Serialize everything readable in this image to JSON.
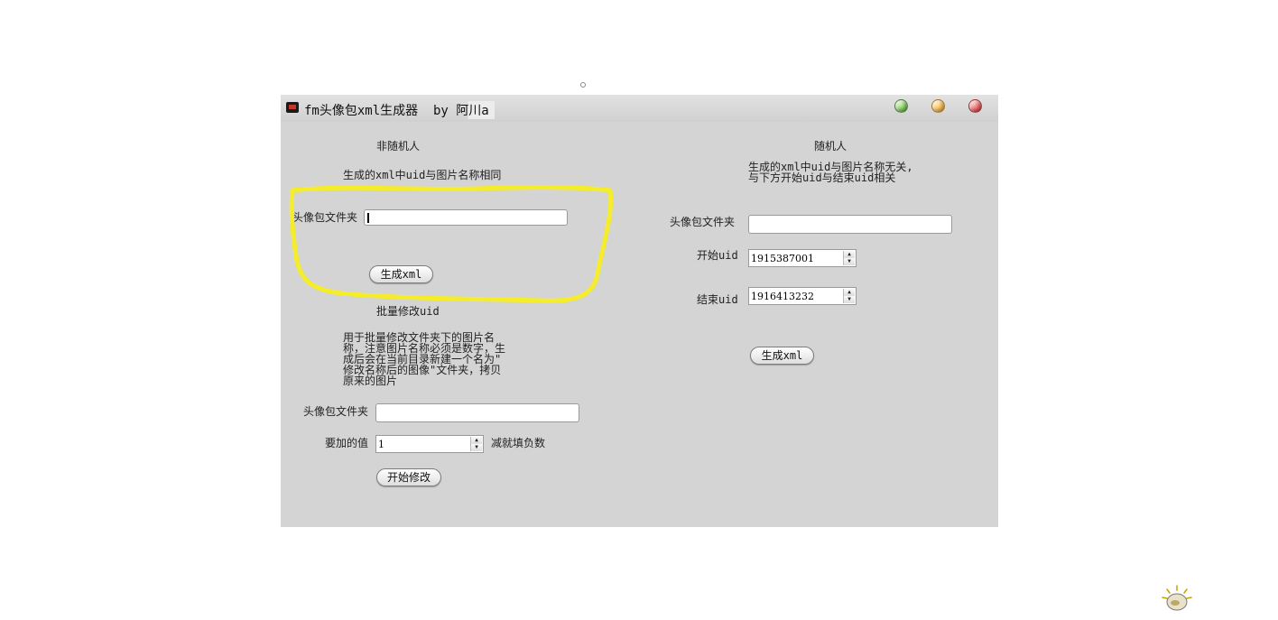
{
  "window": {
    "title": "fm头像包xml生成器  by 阿川a"
  },
  "left": {
    "section_title": "非随机人",
    "description": "生成的xml中uid与图片名称相同",
    "folder_label": "头像包文件夹",
    "folder_value": "",
    "generate_button": "生成xml"
  },
  "batch": {
    "section_title": "批量修改uid",
    "description": "用于批量修改文件夹下的图片名\n称，注意图片名称必须是数字，生\n成后会在当前目录新建一个名为\"\n修改名称后的图像\"文件夹，拷贝\n原来的图片",
    "folder_label": "头像包文件夹",
    "folder_value": "",
    "add_label": "要加的值",
    "add_value": "1",
    "add_hint": "减就填负数",
    "start_button": "开始修改"
  },
  "right": {
    "section_title": "随机人",
    "description": "生成的xml中uid与图片名称无关,\n与下方开始uid与结束uid相关",
    "folder_label": "头像包文件夹",
    "folder_value": "",
    "start_uid_label": "开始uid",
    "start_uid_value": "1915387001",
    "end_uid_label": "结束uid",
    "end_uid_value": "1916413232",
    "generate_button": "生成xml"
  },
  "colors": {
    "window_bg": "#d4d4d4",
    "highlight": "#f5ec2c"
  },
  "icons": {
    "app": "app-logo-icon",
    "min": "green-window-button",
    "max": "orange-window-button",
    "close": "red-window-button",
    "corner": "lamp-mascot-icon"
  }
}
